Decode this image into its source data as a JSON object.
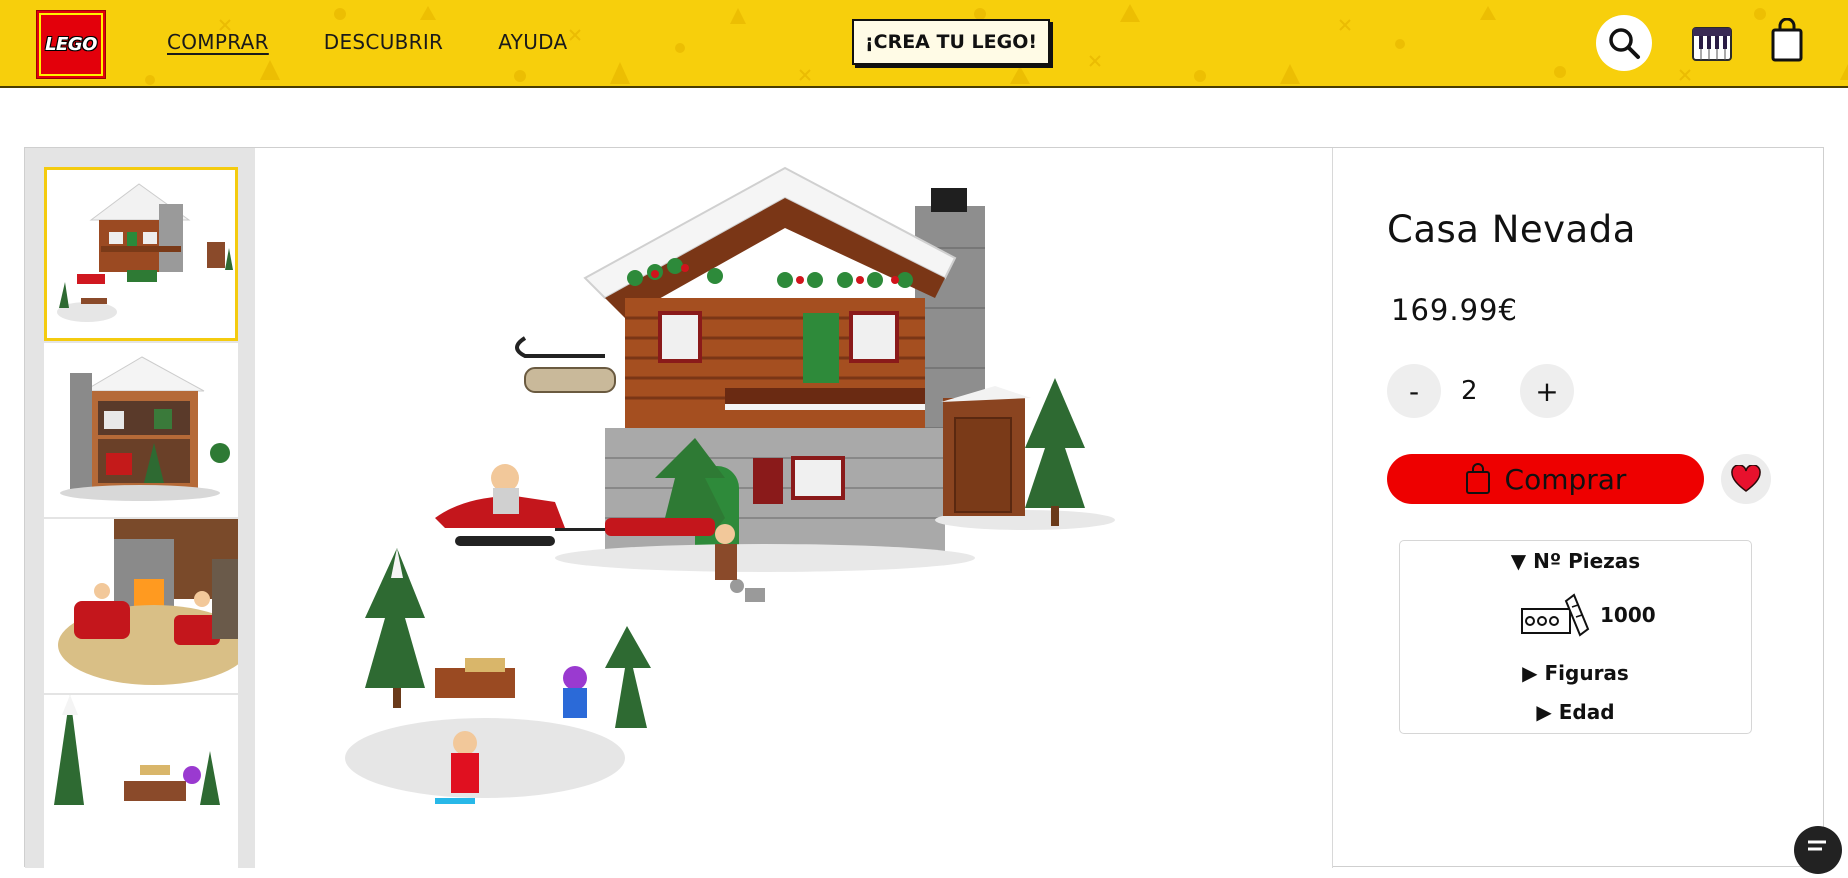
{
  "header": {
    "logo_text": "LEGO",
    "nav": [
      {
        "label": "COMPRAR",
        "active": true
      },
      {
        "label": "DESCUBRIR",
        "active": false
      },
      {
        "label": "AYUDA",
        "active": false
      }
    ],
    "cta_label": "¡CREA TU LEGO!",
    "icons": [
      "search-icon",
      "piano-icon",
      "shopping-bag-icon"
    ],
    "background_color": "#f7cf0c"
  },
  "gallery": {
    "thumbnails": [
      "set-front-view",
      "set-back-view",
      "fireplace-detail",
      "outdoor-scene"
    ],
    "selected_index": 0,
    "selected_border_color": "#f4cb0f"
  },
  "product": {
    "title": "Casa Nevada",
    "price": "169.99€",
    "quantity": "2",
    "minus_label": "-",
    "plus_label": "+",
    "buy_label": "Comprar",
    "buy_color": "#ee0000",
    "specs": {
      "pieces_label": "▼ Nº Piezas",
      "pieces_value": "1000",
      "figures_label": "▶ Figuras",
      "age_label": "▶ Edad"
    }
  }
}
